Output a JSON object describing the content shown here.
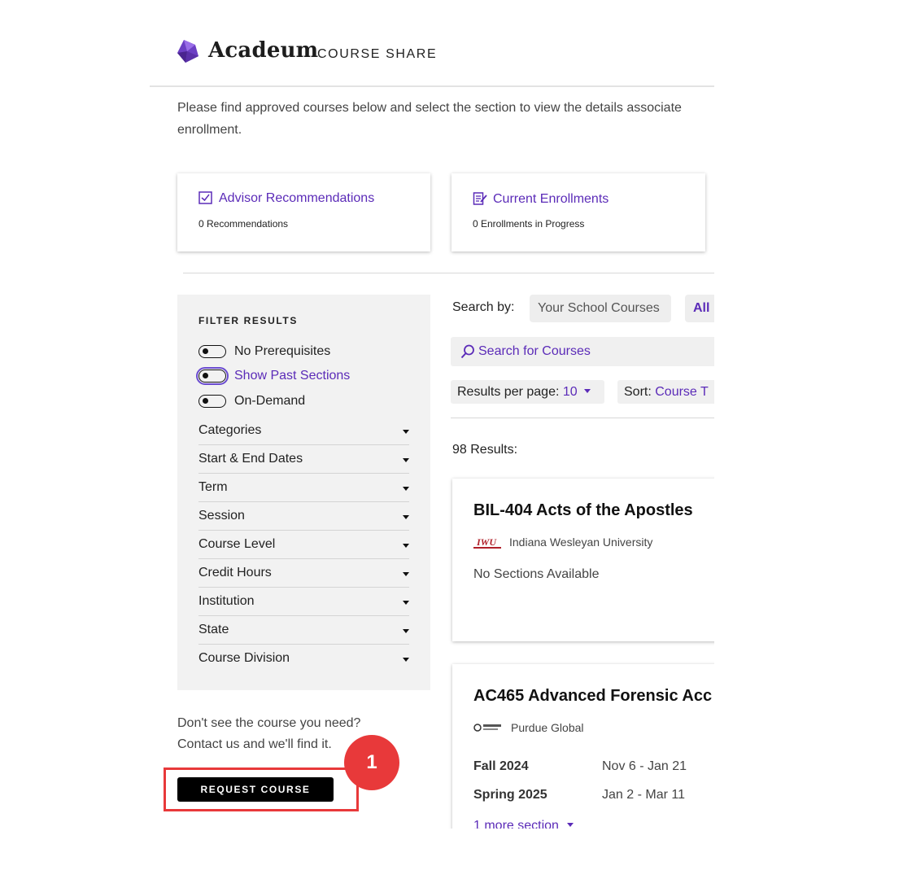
{
  "brand": {
    "name": "Acadeum",
    "product": "COURSE SHARE",
    "accent_color": "#5b2bb8",
    "logo_icon": "acadeum-logo-icon"
  },
  "intro": {
    "line1": "Please find approved courses below and select the section to view the details associate",
    "line2": "enrollment."
  },
  "stats": {
    "advisor": {
      "icon": "checkbox-icon",
      "title": "Advisor Recommendations",
      "subtitle": "0 Recommendations"
    },
    "enrollments": {
      "icon": "clipboard-edit-icon",
      "title": "Current Enrollments",
      "subtitle": "0 Enrollments in Progress"
    }
  },
  "filters": {
    "title": "FILTER RESULTS",
    "toggles": [
      {
        "label": "No Prerequisites",
        "on": false
      },
      {
        "label": "Show Past Sections",
        "on": false,
        "focused": true
      },
      {
        "label": "On-Demand",
        "on": false
      }
    ],
    "facets": [
      "Categories",
      "Start & End Dates",
      "Term",
      "Session",
      "Course Level",
      "Credit Hours",
      "Institution",
      "State",
      "Course Division"
    ]
  },
  "help": {
    "line1": "Don't see the course you need?",
    "line2": "Contact us and we'll find it.",
    "button": "REQUEST COURSE"
  },
  "search": {
    "label": "Search by:",
    "chips": [
      "Your School Courses",
      "All"
    ],
    "placeholder": "Search for Courses"
  },
  "controls": {
    "per_page_label": "Results per page:",
    "per_page_value": "10",
    "sort_label": "Sort:",
    "sort_value": "Course T"
  },
  "results": {
    "count": "98 Results:",
    "courses": [
      {
        "title": "BIL-404 Acts of the Apostles",
        "institution": "Indiana Wesleyan University",
        "logo_text": "IWU",
        "status": "No Sections Available"
      },
      {
        "title": "AC465 Advanced Forensic Acc",
        "institution": "Purdue Global",
        "logo_text": "PURDUE GLOBAL",
        "sections": [
          {
            "term": "Fall 2024",
            "dates": "Nov 6 - Jan 21"
          },
          {
            "term": "Spring 2025",
            "dates": "Jan 2 - Mar 11"
          }
        ],
        "more": "1 more section"
      }
    ]
  },
  "callout": {
    "number": "1",
    "color": "#e8393a"
  }
}
